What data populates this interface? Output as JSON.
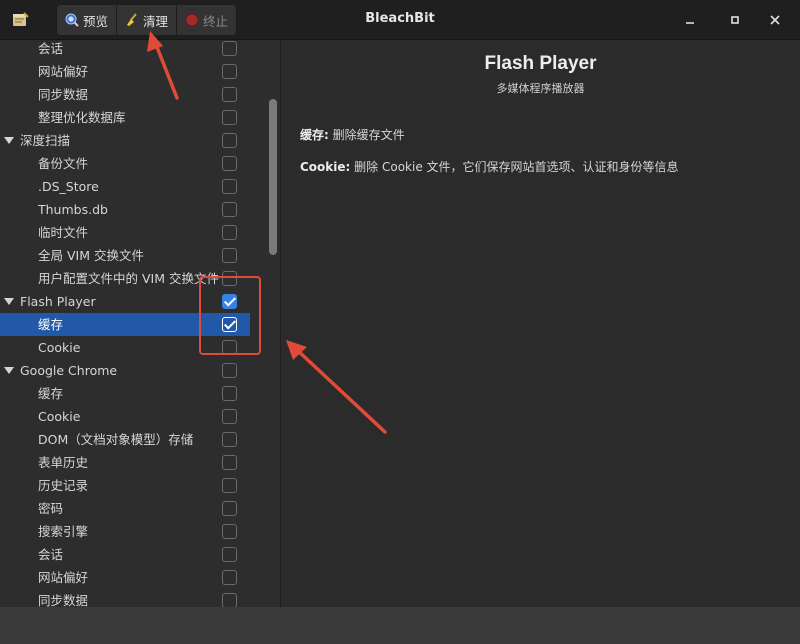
{
  "window": {
    "title": "BleachBit"
  },
  "toolbar": {
    "preview_label": "预览",
    "clean_label": "清理",
    "stop_label": "终止"
  },
  "tree": [
    {
      "kind": "child",
      "label": "会话",
      "checked": false,
      "selected": false
    },
    {
      "kind": "child",
      "label": "网站偏好",
      "checked": false,
      "selected": false
    },
    {
      "kind": "child",
      "label": "同步数据",
      "checked": false,
      "selected": false
    },
    {
      "kind": "child",
      "label": "整理优化数据库",
      "checked": false,
      "selected": false
    },
    {
      "kind": "group",
      "label": "深度扫描",
      "checked": false,
      "selected": false
    },
    {
      "kind": "child",
      "label": "备份文件",
      "checked": false,
      "selected": false
    },
    {
      "kind": "child",
      "label": ".DS_Store",
      "checked": false,
      "selected": false
    },
    {
      "kind": "child",
      "label": "Thumbs.db",
      "checked": false,
      "selected": false
    },
    {
      "kind": "child",
      "label": "临时文件",
      "checked": false,
      "selected": false
    },
    {
      "kind": "child",
      "label": "全局 VIM 交换文件",
      "checked": false,
      "selected": false
    },
    {
      "kind": "child",
      "label": "用户配置文件中的 VIM 交换文件",
      "checked": false,
      "selected": false
    },
    {
      "kind": "group",
      "label": "Flash Player",
      "checked": true,
      "selected": false
    },
    {
      "kind": "child",
      "label": "缓存",
      "checked": true,
      "selected": true
    },
    {
      "kind": "child",
      "label": "Cookie",
      "checked": false,
      "selected": false
    },
    {
      "kind": "group",
      "label": "Google Chrome",
      "checked": false,
      "selected": false
    },
    {
      "kind": "child",
      "label": "缓存",
      "checked": false,
      "selected": false
    },
    {
      "kind": "child",
      "label": "Cookie",
      "checked": false,
      "selected": false
    },
    {
      "kind": "child",
      "label": "DOM（文档对象模型）存储",
      "checked": false,
      "selected": false
    },
    {
      "kind": "child",
      "label": "表单历史",
      "checked": false,
      "selected": false
    },
    {
      "kind": "child",
      "label": "历史记录",
      "checked": false,
      "selected": false
    },
    {
      "kind": "child",
      "label": "密码",
      "checked": false,
      "selected": false
    },
    {
      "kind": "child",
      "label": "搜索引擎",
      "checked": false,
      "selected": false
    },
    {
      "kind": "child",
      "label": "会话",
      "checked": false,
      "selected": false
    },
    {
      "kind": "child",
      "label": "网站偏好",
      "checked": false,
      "selected": false
    },
    {
      "kind": "child",
      "label": "同步数据",
      "checked": false,
      "selected": false
    }
  ],
  "details": {
    "title": "Flash Player",
    "subtitle": "多媒体程序播放器",
    "lines": [
      {
        "term": "缓存:",
        "text": "删除缓存文件"
      },
      {
        "term": "Cookie:",
        "text": "删除 Cookie 文件，它们保存网站首选项、认证和身份等信息"
      }
    ]
  },
  "colors": {
    "selection": "#2158a8",
    "checkbox_checked": "#3584e4",
    "annotation": "#e04a38"
  }
}
